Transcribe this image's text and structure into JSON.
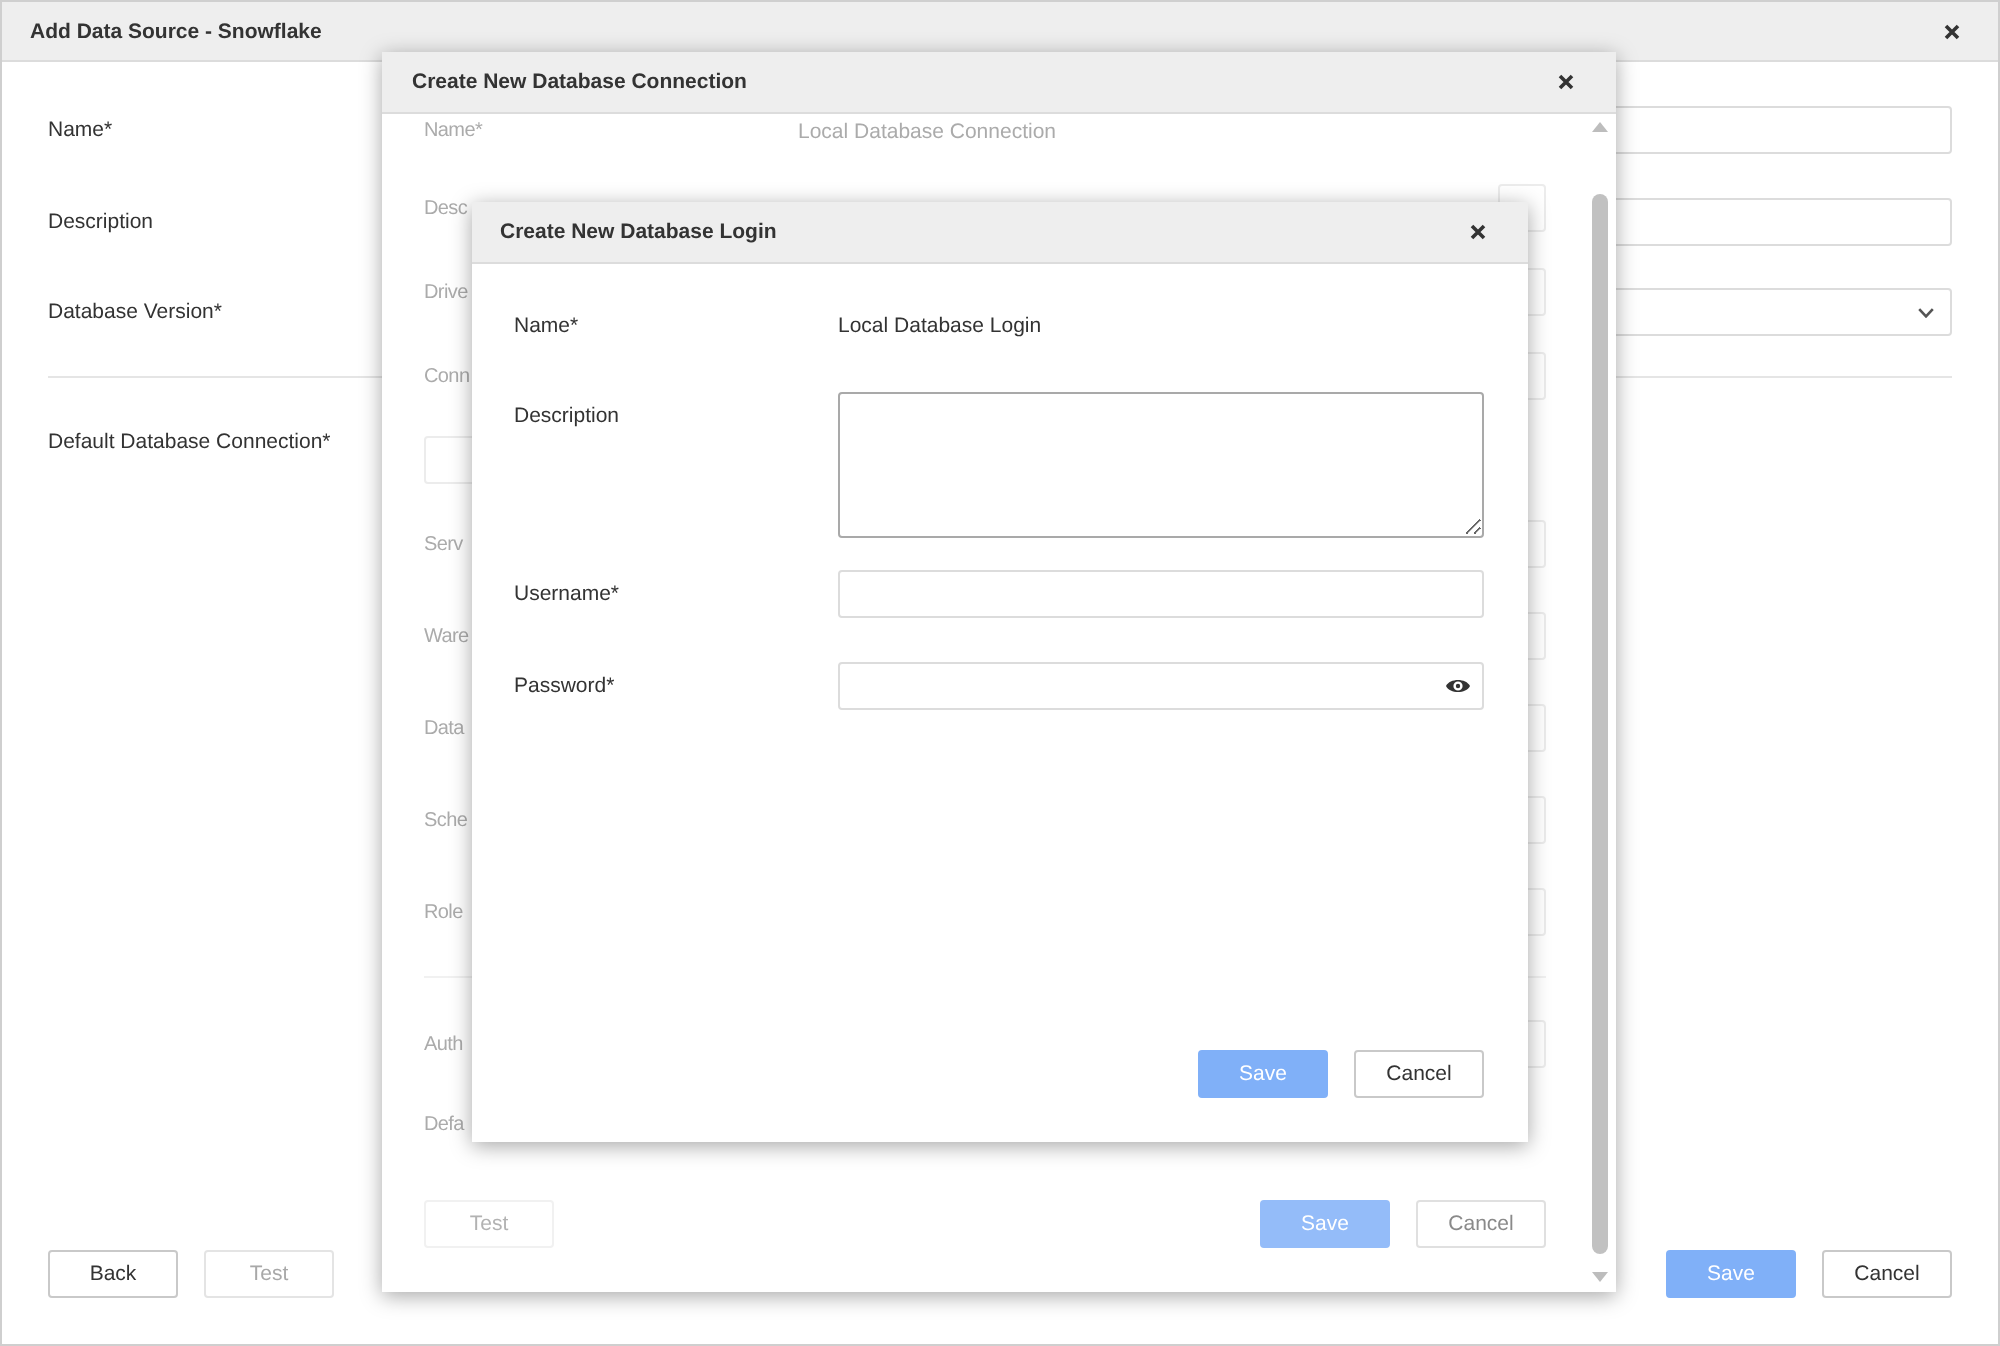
{
  "window": {
    "title": "Add Data Source - Snowflake",
    "sections": [
      [
        {
          "label": "Name*",
          "kind": "input"
        },
        {
          "label": "Description",
          "kind": "input"
        },
        {
          "label": "Database Version*",
          "kind": "select"
        }
      ],
      [
        {
          "label": "Default Database Connection*",
          "kind": "label"
        }
      ]
    ],
    "buttons_left": [
      {
        "label": "Back",
        "kind": "secondary",
        "disabled": false
      },
      {
        "label": "Test",
        "kind": "secondary",
        "disabled": true
      }
    ],
    "buttons_right": [
      {
        "label": "Save",
        "kind": "primary",
        "disabled": true
      },
      {
        "label": "Cancel",
        "kind": "secondary",
        "disabled": false
      }
    ]
  },
  "connection_dialog": {
    "title": "Create New Database Connection",
    "dimmed": true,
    "sections": [
      [
        {
          "label": "Name*",
          "kind": "text",
          "value": "Local Database Connection"
        },
        {
          "label": "Desc",
          "kind": "input"
        },
        {
          "label": "Drive",
          "kind": "input"
        },
        {
          "label": "Conn",
          "kind": "input"
        },
        {
          "kind": "toggle"
        },
        {
          "label": "Serv",
          "kind": "input"
        },
        {
          "label": "Ware",
          "kind": "input"
        },
        {
          "label": "Data",
          "kind": "input"
        },
        {
          "label": "Sche",
          "kind": "input"
        },
        {
          "label": "Role",
          "kind": "input"
        }
      ],
      [
        {
          "label": "Auth",
          "kind": "input"
        },
        {
          "label": "Defa",
          "kind": "label"
        }
      ]
    ],
    "buttons_left": [
      {
        "label": "Test",
        "kind": "secondary",
        "disabled": true
      }
    ],
    "buttons_right": [
      {
        "label": "Save",
        "kind": "primary",
        "disabled": true
      },
      {
        "label": "Cancel",
        "kind": "secondary",
        "disabled": false
      }
    ]
  },
  "login_dialog": {
    "title": "Create New Database Login",
    "sections": [
      [
        {
          "label": "Name*",
          "kind": "text",
          "value": "Local Database Login"
        },
        {
          "label": "Description",
          "kind": "textarea"
        },
        {
          "label": "Username*",
          "kind": "input"
        },
        {
          "label": "Password*",
          "kind": "password"
        }
      ]
    ],
    "buttons_right": [
      {
        "label": "Save",
        "kind": "primary",
        "disabled": true
      },
      {
        "label": "Cancel",
        "kind": "secondary",
        "disabled": false
      }
    ]
  }
}
